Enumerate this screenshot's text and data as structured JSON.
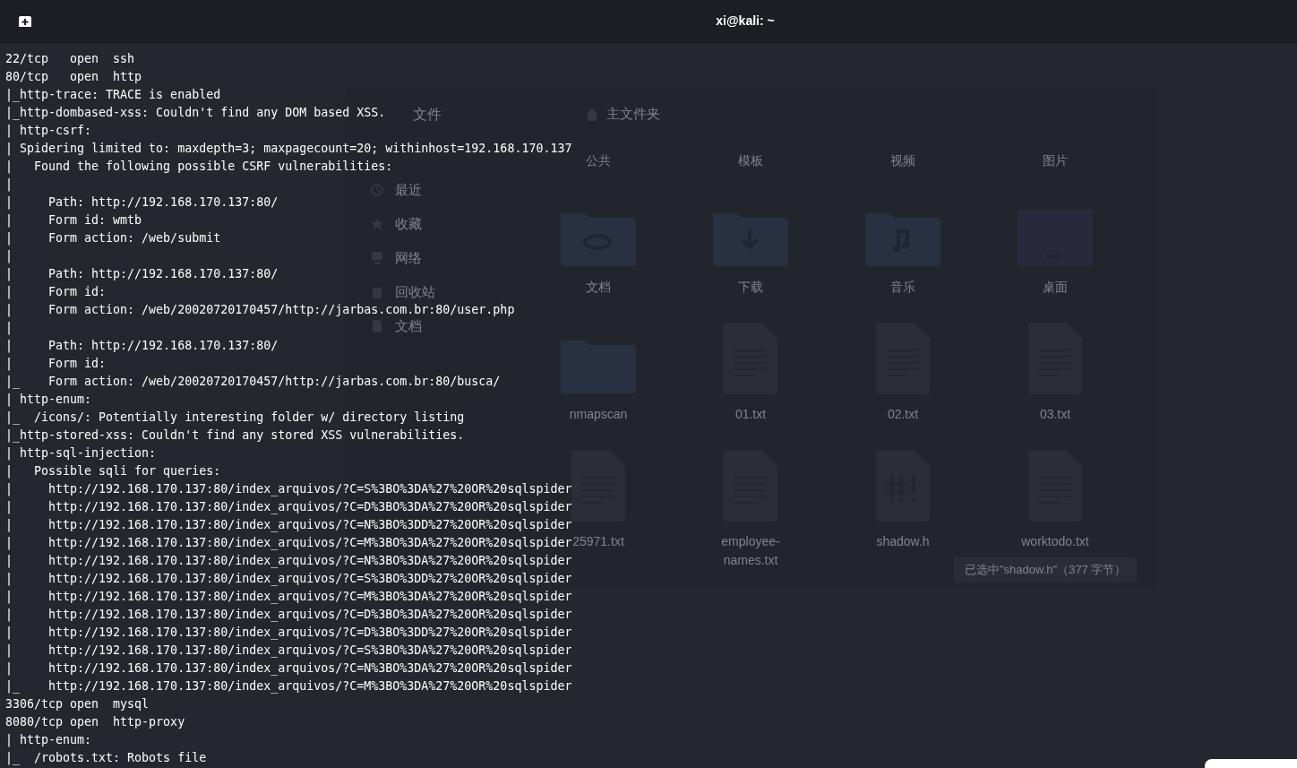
{
  "window": {
    "title": "xi@kali: ~"
  },
  "terminal": {
    "lines": [
      "22/tcp   open  ssh",
      "80/tcp   open  http",
      "|_http-trace: TRACE is enabled",
      "|_http-dombased-xss: Couldn't find any DOM based XSS.",
      "| http-csrf:",
      "| Spidering limited to: maxdepth=3; maxpagecount=20; withinhost=192.168.170.137",
      "|   Found the following possible CSRF vulnerabilities:",
      "|",
      "|     Path: http://192.168.170.137:80/",
      "|     Form id: wmtb",
      "|     Form action: /web/submit",
      "|",
      "|     Path: http://192.168.170.137:80/",
      "|     Form id:",
      "|     Form action: /web/20020720170457/http://jarbas.com.br:80/user.php",
      "|",
      "|     Path: http://192.168.170.137:80/",
      "|     Form id:",
      "|_    Form action: /web/20020720170457/http://jarbas.com.br:80/busca/",
      "| http-enum:",
      "|_  /icons/: Potentially interesting folder w/ directory listing",
      "|_http-stored-xss: Couldn't find any stored XSS vulnerabilities.",
      "| http-sql-injection:",
      "|   Possible sqli for queries:",
      "|     http://192.168.170.137:80/index_arquivos/?C=S%3BO%3DA%27%20OR%20sqlspider",
      "|     http://192.168.170.137:80/index_arquivos/?C=D%3BO%3DA%27%20OR%20sqlspider",
      "|     http://192.168.170.137:80/index_arquivos/?C=N%3BO%3DD%27%20OR%20sqlspider",
      "|     http://192.168.170.137:80/index_arquivos/?C=M%3BO%3DA%27%20OR%20sqlspider",
      "|     http://192.168.170.137:80/index_arquivos/?C=N%3BO%3DA%27%20OR%20sqlspider",
      "|     http://192.168.170.137:80/index_arquivos/?C=S%3BO%3DD%27%20OR%20sqlspider",
      "|     http://192.168.170.137:80/index_arquivos/?C=M%3BO%3DA%27%20OR%20sqlspider",
      "|     http://192.168.170.137:80/index_arquivos/?C=D%3BO%3DA%27%20OR%20sqlspider",
      "|     http://192.168.170.137:80/index_arquivos/?C=D%3BO%3DD%27%20OR%20sqlspider",
      "|     http://192.168.170.137:80/index_arquivos/?C=S%3BO%3DA%27%20OR%20sqlspider",
      "|     http://192.168.170.137:80/index_arquivos/?C=N%3BO%3DA%27%20OR%20sqlspider",
      "|_    http://192.168.170.137:80/index_arquivos/?C=M%3BO%3DA%27%20OR%20sqlspider",
      "3306/tcp open  mysql",
      "8080/tcp open  http-proxy",
      "| http-enum:",
      "|_  /robots.txt: Robots file"
    ]
  },
  "background_window": {
    "header": {
      "title": "文件",
      "location": "主文件夹"
    },
    "sidebar": {
      "items": [
        {
          "label": "最近",
          "kind": "recent"
        },
        {
          "label": "收藏",
          "kind": "starred"
        },
        {
          "label": "网络",
          "kind": "network"
        },
        {
          "label": "回收站",
          "kind": "trash"
        },
        {
          "label": "文档",
          "kind": "document"
        }
      ]
    },
    "files": [
      {
        "name": "公共"
      },
      {
        "name": "模板"
      },
      {
        "name": "视频"
      },
      {
        "name": "图片"
      },
      {
        "name": "文档",
        "kind": "documents"
      },
      {
        "name": "下载",
        "kind": "downloads"
      },
      {
        "name": "音乐",
        "kind": "music"
      },
      {
        "name": "桌面",
        "kind": "desktop"
      },
      {
        "name": "nmapscan",
        "kind": "folder"
      },
      {
        "name": "01.txt",
        "kind": "text"
      },
      {
        "name": "02.txt",
        "kind": "text"
      },
      {
        "name": "03.txt",
        "kind": "text"
      },
      {
        "name": "25971.txt",
        "kind": "text"
      },
      {
        "name": "employee-names.txt",
        "kind": "text"
      },
      {
        "name": "shadow.h",
        "kind": "script"
      },
      {
        "name": "worktodo.txt",
        "kind": "text"
      }
    ],
    "status": "已选中\"shadow.h\"（377 字节）"
  }
}
